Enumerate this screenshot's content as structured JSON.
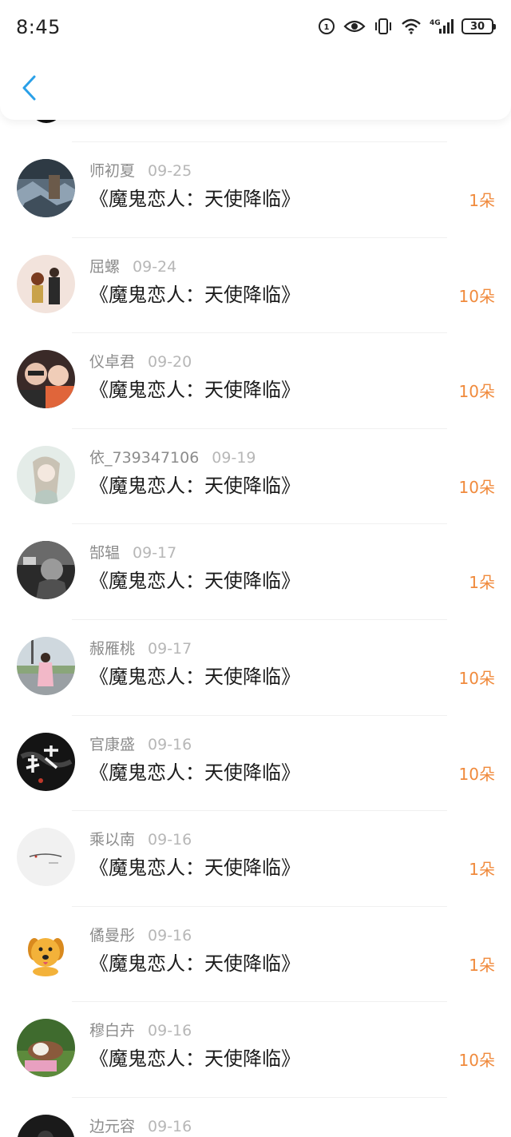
{
  "status_bar": {
    "time": "8:45",
    "network": "4G",
    "battery": "30",
    "icons": [
      "hd-call-icon",
      "eye-icon",
      "vibrate-icon",
      "wifi-icon",
      "signal-icon",
      "battery-icon"
    ]
  },
  "nav": {
    "back_icon": "chevron-left-icon",
    "accent_color": "#2aa0e8"
  },
  "colors": {
    "amount": "#f08a3c",
    "name": "#8c8c8c",
    "date": "#b7b7b7",
    "title": "#1c1c1c"
  },
  "items": [
    {
      "name": "师初夏",
      "date": "09-25",
      "title": "《魔鬼恋人：天使降临》",
      "amount": "1朵"
    },
    {
      "name": "屈螺",
      "date": "09-24",
      "title": "《魔鬼恋人：天使降临》",
      "amount": "10朵"
    },
    {
      "name": "仪卓君",
      "date": "09-20",
      "title": "《魔鬼恋人：天使降临》",
      "amount": "10朵"
    },
    {
      "name": "依_739347106",
      "date": "09-19",
      "title": "《魔鬼恋人：天使降临》",
      "amount": "10朵"
    },
    {
      "name": "郜辒",
      "date": "09-17",
      "title": "《魔鬼恋人：天使降临》",
      "amount": "1朵"
    },
    {
      "name": "赧雁桃",
      "date": "09-17",
      "title": "《魔鬼恋人：天使降临》",
      "amount": "10朵"
    },
    {
      "name": "官康盛",
      "date": "09-16",
      "title": "《魔鬼恋人：天使降临》",
      "amount": "10朵"
    },
    {
      "name": "乘以南",
      "date": "09-16",
      "title": "《魔鬼恋人：天使降临》",
      "amount": "1朵"
    },
    {
      "name": "僪曼彤",
      "date": "09-16",
      "title": "《魔鬼恋人：天使降临》",
      "amount": "1朵"
    },
    {
      "name": "穆白卉",
      "date": "09-16",
      "title": "《魔鬼恋人：天使降临》",
      "amount": "10朵"
    },
    {
      "name": "边元容",
      "date": "09-16",
      "title": "",
      "amount": ""
    }
  ]
}
